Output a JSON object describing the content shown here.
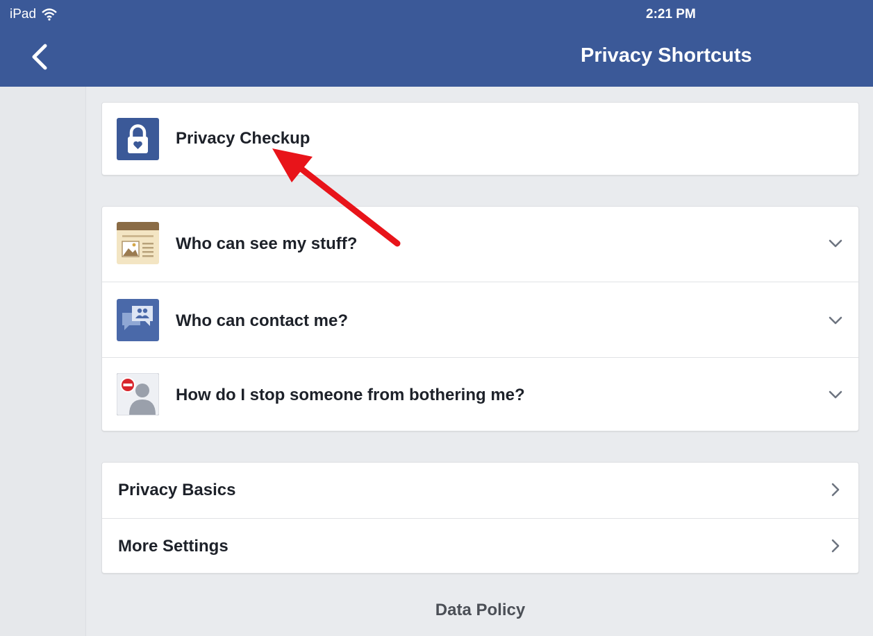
{
  "status_bar": {
    "carrier": "iPad",
    "time": "2:21 PM"
  },
  "nav": {
    "title": "Privacy Shortcuts",
    "back_icon": "chevron-left-icon"
  },
  "cards": {
    "checkup": {
      "label": "Privacy Checkup",
      "icon": "lock-icon"
    },
    "expandable": [
      {
        "label": "Who can see my stuff?",
        "icon": "newsfeed-photo-icon"
      },
      {
        "label": "Who can contact me?",
        "icon": "contact-bubbles-icon"
      },
      {
        "label": "How do I stop someone from bothering me?",
        "icon": "block-person-icon"
      }
    ],
    "links": [
      {
        "label": "Privacy Basics"
      },
      {
        "label": "More Settings"
      }
    ]
  },
  "footer": {
    "data_policy": "Data Policy"
  },
  "colors": {
    "nav_blue": "#3b5998",
    "background": "#e9ebee",
    "annotation_arrow": "#e8141a"
  }
}
